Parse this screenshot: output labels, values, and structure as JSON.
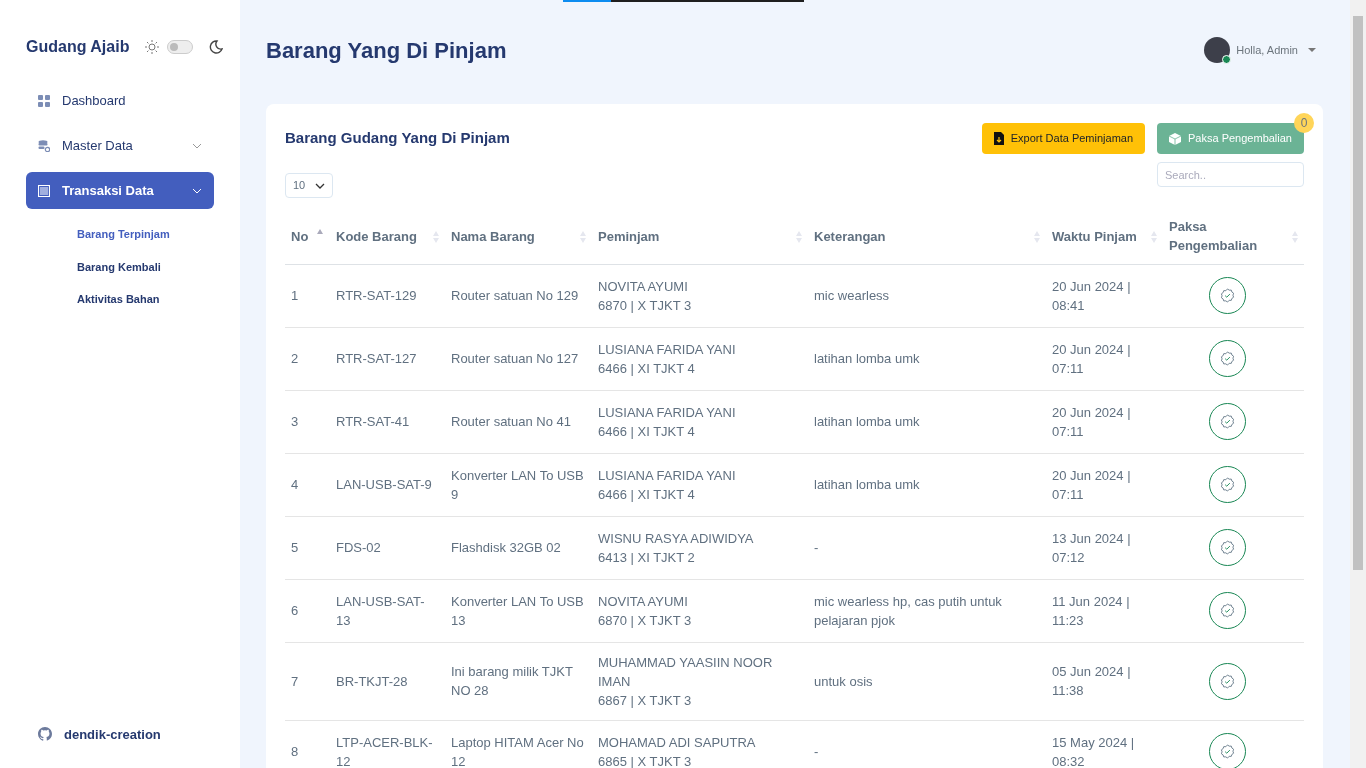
{
  "loading_bar": {
    "level": 0.2
  },
  "brand": "Gudang Ajaib",
  "dark_mode": false,
  "sidebar": {
    "items": [
      {
        "label": "Dashboard",
        "kind": "link",
        "selected": false
      },
      {
        "label": "Master Data",
        "kind": "group",
        "selected": false
      },
      {
        "label": "Transaksi Data",
        "kind": "group",
        "selected": true,
        "expanded": true,
        "children": [
          {
            "label": "Barang Terpinjam",
            "selected": true
          },
          {
            "label": "Barang Kembali",
            "selected": false
          },
          {
            "label": "Aktivitas Bahan",
            "selected": false
          }
        ]
      }
    ],
    "footer": "dendik-creation"
  },
  "page_title": "Barang Yang Di Pinjam",
  "user": {
    "greeting": "Holla, Admin",
    "online": true
  },
  "card": {
    "title": "Barang Gudang Yang Di Pinjam",
    "buttons": [
      {
        "label": "Export Data Peminjaman",
        "kind": "export"
      },
      {
        "label": "Paksa Pengembalian",
        "kind": "force",
        "badge": "0"
      }
    ],
    "page_size": "10",
    "search_placeholder": "Search..",
    "columns": [
      {
        "label": "No",
        "sorted": true
      },
      {
        "label": "Kode Barang",
        "sorted": false
      },
      {
        "label": "Nama Barang",
        "sorted": false
      },
      {
        "label": "Peminjam",
        "sorted": false
      },
      {
        "label": "Keterangan",
        "sorted": false
      },
      {
        "label": "Waktu Pinjam",
        "sorted": false
      },
      {
        "label": "Paksa Pengembalian",
        "sorted": false
      }
    ],
    "rows": [
      {
        "no": "1",
        "kode": "RTR-SAT-129",
        "nama": "Router satuan No 129",
        "peminjam": [
          "NOVITA AYUMI",
          "6870 | X TJKT 3"
        ],
        "keterangan": "mic wearless",
        "waktu": "20 Jun 2024 | 08:41"
      },
      {
        "no": "2",
        "kode": "RTR-SAT-127",
        "nama": "Router satuan No 127",
        "peminjam": [
          "LUSIANA FARIDA YANI",
          "6466 | XI TJKT 4"
        ],
        "keterangan": "latihan lomba umk",
        "waktu": "20 Jun 2024 | 07:11"
      },
      {
        "no": "3",
        "kode": "RTR-SAT-41",
        "nama": "Router satuan No 41",
        "peminjam": [
          "LUSIANA FARIDA YANI",
          "6466 | XI TJKT 4"
        ],
        "keterangan": "latihan lomba umk",
        "waktu": "20 Jun 2024 | 07:11"
      },
      {
        "no": "4",
        "kode": "LAN-USB-SAT-9",
        "nama": "Konverter LAN To USB 9",
        "peminjam": [
          "LUSIANA FARIDA YANI",
          "6466 | XI TJKT 4"
        ],
        "keterangan": "latihan lomba umk",
        "waktu": "20 Jun 2024 | 07:11"
      },
      {
        "no": "5",
        "kode": "FDS-02",
        "nama": "Flashdisk 32GB 02",
        "peminjam": [
          "WISNU RASYA ADIWIDYA",
          "6413 | XI TJKT 2"
        ],
        "keterangan": "-",
        "waktu": "13 Jun 2024 | 07:12"
      },
      {
        "no": "6",
        "kode": "LAN-USB-SAT-13",
        "nama": "Konverter LAN To USB 13",
        "peminjam": [
          "NOVITA AYUMI",
          "6870 | X TJKT 3"
        ],
        "keterangan": "mic wearless hp, cas putih untuk pelajaran pjok",
        "waktu": "11 Jun 2024 | 11:23"
      },
      {
        "no": "7",
        "kode": "BR-TKJT-28",
        "nama": "Ini barang milik TJKT NO 28",
        "peminjam": [
          "MUHAMMAD YAASIIN NOOR IMAN",
          "6867 | X TJKT 3"
        ],
        "keterangan": "untuk osis",
        "waktu": "05 Jun 2024 | 11:38"
      },
      {
        "no": "8",
        "kode": "LTP-ACER-BLK-12",
        "nama": "Laptop HITAM Acer No 12",
        "peminjam": [
          "MOHAMAD ADI SAPUTRA",
          "6865 | X TJKT 3"
        ],
        "keterangan": "-",
        "waktu": "15 May 2024 | 08:32"
      }
    ]
  }
}
